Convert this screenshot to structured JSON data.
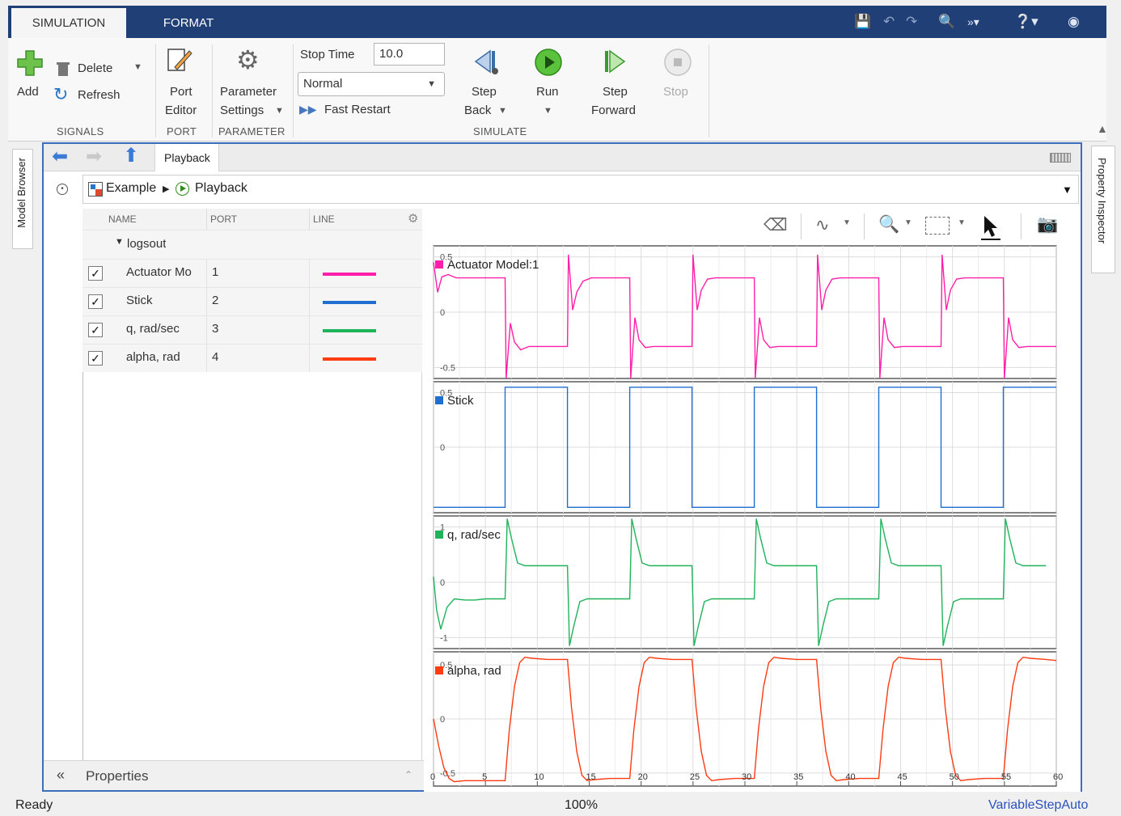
{
  "tabs": [
    {
      "label": "SIMULATION"
    },
    {
      "label": "FORMAT"
    }
  ],
  "ribbon": {
    "signals": {
      "add": "Add",
      "delete": "Delete",
      "refresh": "Refresh",
      "group": "SIGNALS"
    },
    "port": {
      "line1": "Port",
      "line2": "Editor",
      "group": "PORT"
    },
    "parameter": {
      "line1": "Parameter",
      "line2": "Settings",
      "group": "PARAMETER"
    },
    "simulate": {
      "stop_time_label": "Stop Time",
      "stop_time_value": "10.0",
      "mode": "Normal",
      "fast_restart": "Fast Restart",
      "step_back_1": "Step",
      "step_back_2": "Back",
      "run": "Run",
      "step_fwd_1": "Step",
      "step_fwd_2": "Forward",
      "stop": "Stop",
      "group": "SIMULATE"
    }
  },
  "side": {
    "left": "Model Browser",
    "right": "Property Inspector"
  },
  "nav": {
    "tab": "Playback"
  },
  "path": {
    "root": "Example",
    "child": "Playback"
  },
  "table": {
    "headers": {
      "name": "NAME",
      "port": "PORT",
      "line": "LINE"
    },
    "group": "logsout",
    "rows": [
      {
        "name": "Actuator Mo",
        "port": "1",
        "color": "#ff1fa8",
        "checked": "✓"
      },
      {
        "name": "Stick",
        "port": "2",
        "color": "#1f6fd0",
        "checked": "✓"
      },
      {
        "name": "q, rad/sec",
        "port": "3",
        "color": "#1fb35c",
        "checked": "✓"
      },
      {
        "name": "alpha, rad",
        "port": "4",
        "color": "#ff3b12",
        "checked": "✓"
      }
    ]
  },
  "properties": {
    "label": "Properties"
  },
  "status": {
    "left": "Ready",
    "center": "100%",
    "right": "VariableStepAuto"
  },
  "chart_data": [
    {
      "type": "line",
      "title": "Actuator Model:1",
      "color": "#ff1fa8",
      "xlim": [
        0,
        60
      ],
      "ylim": [
        -0.6,
        0.6
      ],
      "yticks": [
        {
          "v": 0.5,
          "label": "0.5"
        },
        {
          "v": 0,
          "label": "0"
        },
        {
          "v": -0.5,
          "label": "-0.5"
        }
      ],
      "x": [
        0,
        0.4,
        0.8,
        1.4,
        2.2,
        3,
        4,
        5,
        6,
        6.9,
        7.0,
        7.4,
        7.8,
        8.4,
        9.2,
        10,
        11,
        12,
        12.9,
        13.0,
        13.4,
        13.8,
        14.4,
        15.2,
        16,
        17,
        18,
        18.9,
        19.0,
        19.4,
        19.8,
        20.4,
        21.2,
        22,
        23,
        24,
        24.9,
        25.0,
        25.4,
        25.8,
        26.4,
        27.2,
        28,
        29,
        30,
        30.9,
        31.0,
        31.4,
        31.8,
        32.4,
        33.2,
        34,
        35,
        36,
        36.9,
        37.0,
        37.4,
        37.8,
        38.4,
        39.2,
        40,
        41,
        42,
        42.9,
        43.0,
        43.4,
        43.8,
        44.4,
        45.2,
        46,
        47,
        48,
        48.9,
        49.0,
        49.4,
        49.8,
        50.4,
        51.2,
        52,
        53,
        54,
        54.9,
        55.0,
        55.4,
        55.8,
        56.4,
        57.2,
        58,
        59,
        60
      ],
      "y": [
        0.45,
        0.18,
        0.32,
        0.34,
        0.31,
        0.31,
        0.31,
        0.31,
        0.31,
        0.31,
        -0.6,
        -0.1,
        -0.27,
        -0.34,
        -0.31,
        -0.31,
        -0.31,
        -0.31,
        -0.31,
        0.52,
        0.02,
        0.18,
        0.28,
        0.31,
        0.31,
        0.31,
        0.31,
        0.31,
        -0.6,
        -0.05,
        -0.25,
        -0.32,
        -0.31,
        -0.31,
        -0.31,
        -0.31,
        -0.31,
        0.52,
        0.02,
        0.2,
        0.3,
        0.31,
        0.31,
        0.31,
        0.31,
        0.31,
        -0.6,
        -0.05,
        -0.25,
        -0.32,
        -0.31,
        -0.31,
        -0.31,
        -0.31,
        -0.31,
        0.52,
        0.02,
        0.2,
        0.3,
        0.31,
        0.31,
        0.31,
        0.31,
        0.31,
        -0.6,
        -0.05,
        -0.25,
        -0.32,
        -0.31,
        -0.31,
        -0.31,
        -0.31,
        -0.31,
        0.52,
        0.02,
        0.2,
        0.3,
        0.31,
        0.31,
        0.31,
        0.31,
        0.31,
        -0.6,
        -0.05,
        -0.25,
        -0.32,
        -0.31,
        -0.31,
        -0.31,
        -0.31,
        -0.31
      ]
    },
    {
      "type": "line",
      "title": "Stick",
      "color": "#1f6fd0",
      "xlim": [
        0,
        60
      ],
      "ylim": [
        -0.6,
        0.6
      ],
      "yticks": [
        {
          "v": 0.5,
          "label": "0.5"
        },
        {
          "v": 0,
          "label": "0"
        }
      ],
      "x": [
        0,
        6.9,
        6.9,
        12.9,
        12.9,
        18.9,
        18.9,
        24.9,
        24.9,
        30.9,
        30.9,
        36.9,
        36.9,
        42.9,
        42.9,
        48.9,
        48.9,
        54.9,
        54.9,
        60
      ],
      "y": [
        -0.55,
        -0.55,
        0.55,
        0.55,
        -0.55,
        -0.55,
        0.55,
        0.55,
        -0.55,
        -0.55,
        0.55,
        0.55,
        -0.55,
        -0.55,
        0.55,
        0.55,
        -0.55,
        -0.55,
        0.55,
        0.55
      ]
    },
    {
      "type": "line",
      "title": "q, rad/sec",
      "color": "#1fb35c",
      "xlim": [
        0,
        60
      ],
      "ylim": [
        -1.2,
        1.2
      ],
      "yticks": [
        {
          "v": 1,
          "label": "1"
        },
        {
          "v": 0,
          "label": "0"
        },
        {
          "v": -1,
          "label": "-1"
        }
      ],
      "x": [
        0,
        0.3,
        0.7,
        1.3,
        2,
        3,
        4,
        5,
        6,
        6.9,
        7.1,
        7.5,
        8.1,
        8.8,
        9.6,
        11,
        12,
        12.9,
        13.1,
        13.5,
        14.1,
        14.8,
        15.6,
        17,
        18,
        18.9,
        19.1,
        19.5,
        20.1,
        20.8,
        21.6,
        23,
        24,
        24.9,
        25.1,
        25.5,
        26.1,
        26.8,
        27.6,
        29,
        30,
        30.9,
        31.1,
        31.5,
        32.1,
        32.8,
        33.6,
        35,
        36,
        36.9,
        37.1,
        37.5,
        38.1,
        38.8,
        39.6,
        41,
        42,
        42.9,
        43.1,
        43.5,
        44.1,
        44.8,
        45.6,
        47,
        48,
        48.9,
        49.1,
        49.5,
        50.1,
        50.8,
        51.6,
        53,
        54,
        54.9,
        55.1,
        55.5,
        56.1,
        56.8,
        57.6,
        59,
        60
      ],
      "y": [
        0.1,
        -0.5,
        -0.85,
        -0.45,
        -0.3,
        -0.32,
        -0.32,
        -0.3,
        -0.3,
        -0.3,
        1.15,
        0.8,
        0.35,
        0.3,
        0.3,
        0.3,
        0.3,
        0.3,
        -1.15,
        -0.8,
        -0.35,
        -0.3,
        -0.3,
        -0.3,
        -0.3,
        -0.3,
        1.15,
        0.8,
        0.35,
        0.3,
        0.3,
        0.3,
        0.3,
        0.3,
        -1.15,
        -0.8,
        -0.35,
        -0.3,
        -0.3,
        -0.3,
        -0.3,
        -0.3,
        1.15,
        0.8,
        0.35,
        0.3,
        0.3,
        0.3,
        0.3,
        0.3,
        -1.15,
        -0.8,
        -0.35,
        -0.3,
        -0.3,
        -0.3,
        -0.3,
        -0.3,
        1.15,
        0.8,
        0.35,
        0.3,
        0.3,
        0.3,
        0.3,
        0.3,
        -1.15,
        -0.8,
        -0.35,
        -0.3,
        -0.3,
        -0.3,
        -0.3,
        -0.3,
        1.15,
        0.8,
        0.35,
        0.3,
        0.3,
        0.3
      ]
    },
    {
      "type": "line",
      "title": "alpha, rad",
      "color": "#ff3b12",
      "xlim": [
        0,
        60
      ],
      "ylim": [
        -0.62,
        0.62
      ],
      "yticks": [
        {
          "v": 0.5,
          "label": "0.5"
        },
        {
          "v": 0,
          "label": "0"
        },
        {
          "v": -0.5,
          "label": "-0.5"
        }
      ],
      "x": [
        0,
        0.5,
        1,
        1.5,
        2,
        3,
        4,
        5,
        6,
        6.9,
        7.3,
        7.8,
        8.3,
        8.8,
        9.5,
        11,
        12,
        12.9,
        13.3,
        13.8,
        14.3,
        14.8,
        15.5,
        17,
        18,
        18.9,
        19.3,
        19.8,
        20.3,
        20.8,
        21.5,
        23,
        24,
        24.9,
        25.3,
        25.8,
        26.3,
        26.8,
        27.5,
        29,
        30,
        30.9,
        31.3,
        31.8,
        32.3,
        32.8,
        33.5,
        35,
        36,
        36.9,
        37.3,
        37.8,
        38.3,
        38.8,
        39.5,
        41,
        42,
        42.9,
        43.3,
        43.8,
        44.3,
        44.8,
        45.5,
        47,
        48,
        48.9,
        49.3,
        49.8,
        50.3,
        50.8,
        51.5,
        53,
        54,
        54.9,
        55.3,
        55.8,
        56.3,
        56.8,
        57.5,
        59,
        60
      ],
      "y": [
        0,
        -0.25,
        -0.45,
        -0.55,
        -0.58,
        -0.57,
        -0.57,
        -0.57,
        -0.57,
        -0.57,
        -0.1,
        0.3,
        0.52,
        0.57,
        0.56,
        0.55,
        0.55,
        0.55,
        0.1,
        -0.3,
        -0.52,
        -0.57,
        -0.56,
        -0.55,
        -0.55,
        -0.55,
        -0.1,
        0.3,
        0.52,
        0.57,
        0.56,
        0.55,
        0.55,
        0.55,
        0.1,
        -0.3,
        -0.52,
        -0.57,
        -0.56,
        -0.55,
        -0.55,
        -0.55,
        -0.1,
        0.3,
        0.52,
        0.57,
        0.56,
        0.55,
        0.55,
        0.55,
        0.1,
        -0.3,
        -0.52,
        -0.57,
        -0.56,
        -0.55,
        -0.55,
        -0.55,
        -0.1,
        0.3,
        0.52,
        0.57,
        0.56,
        0.55,
        0.55,
        0.55,
        0.1,
        -0.3,
        -0.52,
        -0.57,
        -0.56,
        -0.55,
        -0.55,
        -0.55,
        -0.1,
        0.3,
        0.52,
        0.57,
        0.56,
        0.55,
        0.54
      ],
      "xticks": [
        0,
        5,
        10,
        15,
        20,
        25,
        30,
        35,
        40,
        45,
        50,
        55,
        60
      ]
    }
  ]
}
